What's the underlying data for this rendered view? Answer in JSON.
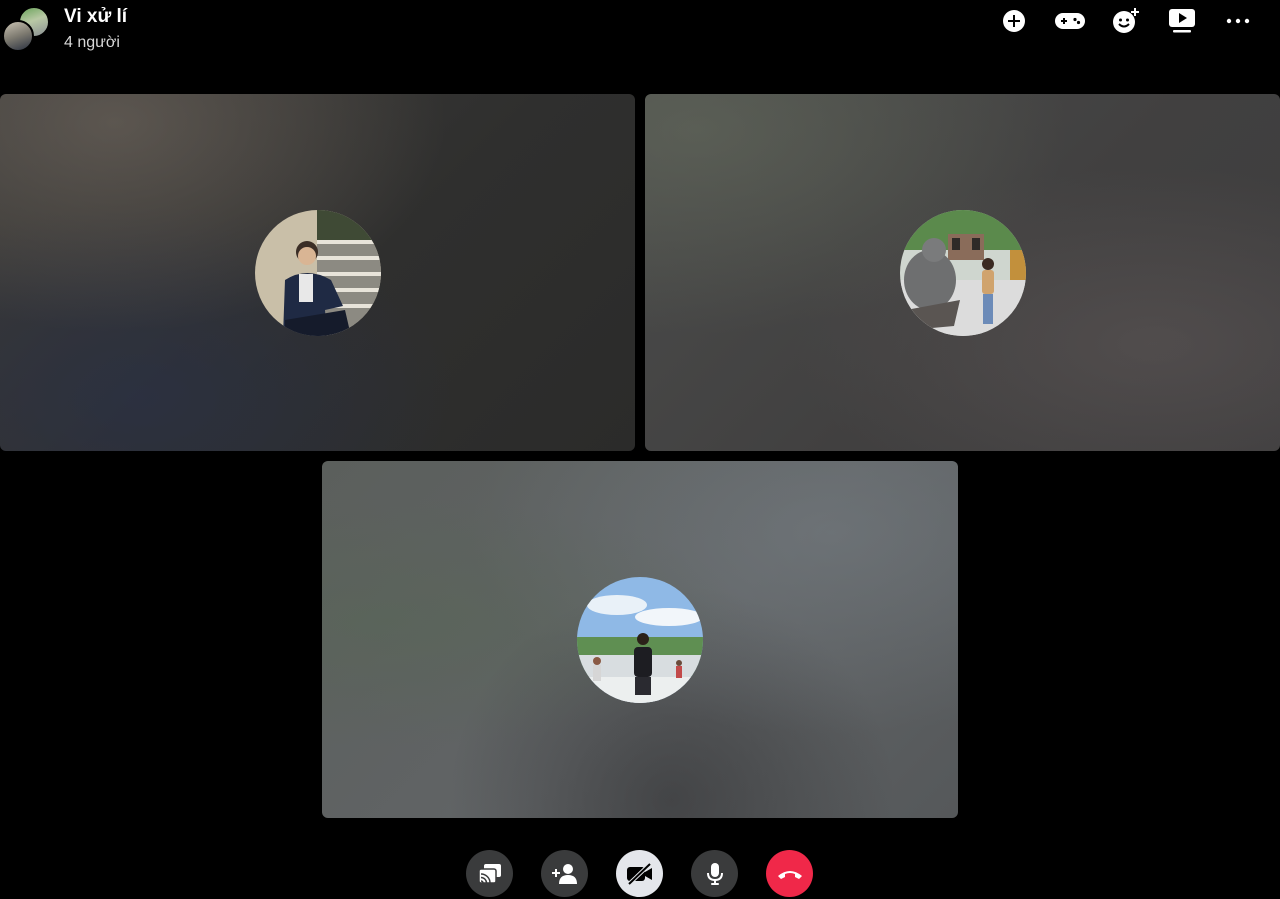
{
  "header": {
    "title": "Vi xử lí",
    "subtitle": "4 người",
    "group_avatar": "group-avatar"
  },
  "top_actions": [
    {
      "name": "add-icon"
    },
    {
      "name": "game-controller-icon"
    },
    {
      "name": "effects-icon"
    },
    {
      "name": "watch-together-icon"
    },
    {
      "name": "more-icon"
    }
  ],
  "participants": [
    {
      "name": "participant-1",
      "avatar": "person-sitting-on-stairs"
    },
    {
      "name": "participant-2",
      "avatar": "person-with-buddha-statue"
    },
    {
      "name": "participant-3",
      "avatar": "person-outdoor-fountain"
    }
  ],
  "controls": [
    {
      "name": "share-screen-icon"
    },
    {
      "name": "add-person-icon"
    },
    {
      "name": "camera-off-icon",
      "state": "camera off"
    },
    {
      "name": "microphone-icon"
    },
    {
      "name": "end-call-icon",
      "color": "#f02849"
    }
  ],
  "colors": {
    "background": "#000000",
    "control_bg": "#3a3b3c",
    "control_light": "#e4e6eb",
    "end_call": "#f02849"
  }
}
